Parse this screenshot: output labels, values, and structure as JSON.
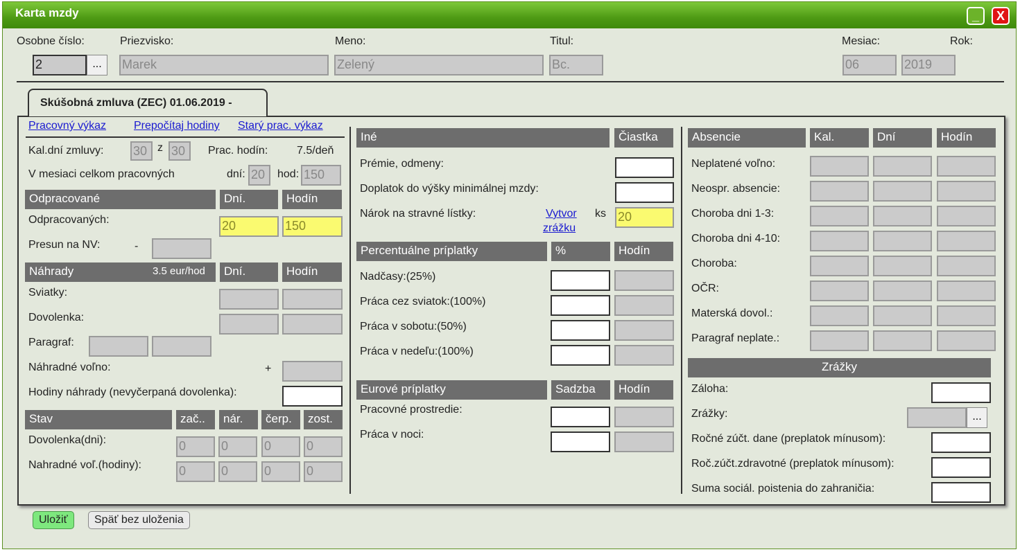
{
  "window": {
    "title": "Karta mzdy",
    "min_label": "_",
    "close_label": "X"
  },
  "header": {
    "osobne_label": "Osobne číslo:",
    "osobne_value": "2",
    "ellipsis": "...",
    "priezvisko_label": "Priezvisko:",
    "priezvisko_value": "Marek",
    "meno_label": "Meno:",
    "meno_value": "Zelený",
    "titul_label": "Titul:",
    "titul_value": "Bc.",
    "mesiac_label": "Mesiac:",
    "mesiac_value": "06",
    "rok_label": "Rok:",
    "rok_value": "2019"
  },
  "tab": {
    "label": "Skúšobná zmluva (ZEC) 01.06.2019 -"
  },
  "links": {
    "pracovny": "Pracovný výkaz",
    "prepocitaj": "Prepočítaj hodiny",
    "stary": "Starý prac. výkaz"
  },
  "left": {
    "kal_label": "Kal.dní zmluvy:",
    "kal_v1": "30",
    "kal_z": "z",
    "kal_v2": "30",
    "prac_hodin_label": "Prac. hodín:",
    "prac_hodin_value": "7.5/deň",
    "mesiac_celkom_label": "V mesiaci celkom pracovných",
    "dni_label": "dní:",
    "dni_value": "20",
    "hod_label": "hod:",
    "hod_value": "150",
    "odpracovane_hdr": "Odpracované",
    "dni_hdr": "Dní.",
    "hodin_hdr": "Hodín",
    "odpracovanych_label": "Odpracovaných:",
    "odpracovanych_dni": "20",
    "odpracovanych_hod": "150",
    "presun_label": "Presun na NV:",
    "presun_dash": "-",
    "nahrady_hdr": "Náhrady",
    "nahrady_rate": "3.5 eur/hod",
    "sviatky_label": "Sviatky:",
    "dovolenka_label": "Dovolenka:",
    "paragraf_label": "Paragraf:",
    "nahradne_volno_label": "Náhradné voľno:",
    "plus": "+",
    "hodiny_nahrady_label": "Hodiny náhrady (nevyčerpaná dovolenka):",
    "stav_hdr": "Stav",
    "zac_hdr": "zač..",
    "nar_hdr": "nár.",
    "cerp_hdr": "čerp.",
    "zost_hdr": "zost.",
    "stav_rows": [
      {
        "label": "Dovolenka(dni):",
        "values": [
          "0",
          "0",
          "0",
          "0"
        ]
      },
      {
        "label": "Nahradné voľ.(hodiny):",
        "values": [
          "0",
          "0",
          "0",
          "0"
        ]
      }
    ]
  },
  "middle": {
    "ine_hdr": "Iné",
    "ciastka_hdr": "Čiastka",
    "premie_label": "Prémie, odmeny:",
    "doplatok_label": "Doplatok do výšky minimálnej mzdy:",
    "narok_label": "Nárok na stravné lístky:",
    "vytvor_link_1": "Vytvor",
    "vytvor_link_2": "zrážku",
    "ks_label": "ks",
    "ks_value": "20",
    "percent_hdr": "Percentuálne príplatky",
    "pct_hdr": "%",
    "hodin_hdr": "Hodín",
    "percent_rows": [
      "Nadčasy:(25%)",
      "Práca cez sviatok:(100%)",
      "Práca v sobotu:(50%)",
      "Práca v nedeľu:(100%)"
    ],
    "eurove_hdr": "Eurové príplatky",
    "sadzba_hdr": "Sadzba",
    "eurove_rows": [
      "Pracovné prostredie:",
      "Práca v noci:"
    ]
  },
  "right": {
    "absencie_hdr": "Absencie",
    "kal_hdr": "Kal.",
    "dni_hdr": "Dní",
    "hodin_hdr": "Hodín",
    "absencie_rows": [
      "Neplatené voľno:",
      "Neospr. absencie:",
      "Choroba dni 1-3:",
      "Choroba dni 4-10:",
      "Choroba:",
      "OČR:",
      "Materská dovol.:",
      "Paragraf neplate.:"
    ],
    "zrazky_hdr": "Zrážky",
    "zaloha_label": "Záloha:",
    "zrazky_label": "Zrážky:",
    "ellipsis": "...",
    "rocne_dane_label": "Ročné zúčt. dane (preplatok mínusom):",
    "roc_zdrav_label": "Roč.zúčt.zdravotné (preplatok mínusom):",
    "suma_label": "Suma sociál. poistenia do zahraničia:"
  },
  "footer": {
    "save": "Uložiť",
    "back": "Späť bez uloženia"
  },
  "colors": {
    "title_green": "#4e9a14",
    "header_gray": "#6d6d6d",
    "yellow": "#fafa70",
    "save_green": "#7ee87e"
  }
}
